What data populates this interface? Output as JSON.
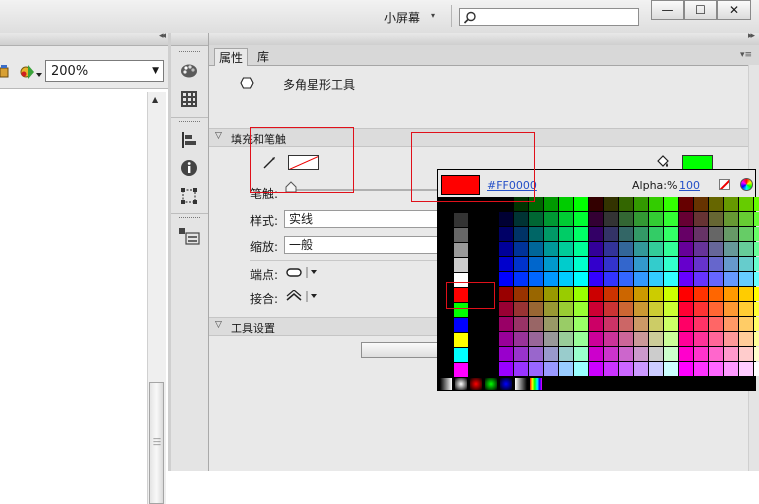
{
  "topbar": {
    "workspace_label": "小屏幕",
    "workspace_arrow": "▾",
    "search_value": "",
    "window_buttons": [
      "—",
      "☐",
      "✕"
    ]
  },
  "left_pane": {
    "zoom_value": "200%"
  },
  "properties_panel": {
    "tabs": [
      {
        "label": "属性",
        "active": true
      },
      {
        "label": "库",
        "active": false
      }
    ],
    "tool_name": "多角星形工具",
    "sections": {
      "fill_stroke": "填充和笔触",
      "tool_settings": "工具设置"
    },
    "fields": {
      "stroke_label": "笔触:",
      "style_label": "样式:",
      "style_value": "实线",
      "scale_label": "缩放:",
      "scale_value": "一般",
      "cap_label": "端点:",
      "join_label": "接合:"
    },
    "fill_color": "#00ff00"
  },
  "color_popup": {
    "selected_color": "#ff0000",
    "hex_text": "#FF0000",
    "alpha_label": "Alpha:%",
    "alpha_value": "100",
    "left_column": [
      "#000000",
      "#333333",
      "#666666",
      "#999999",
      "#cccccc",
      "#ffffff",
      "#ff0000",
      "#00ff00",
      "#0000ff",
      "#ffff00",
      "#00ffff",
      "#ff00ff"
    ],
    "gradients": [
      "#000000 to #ffffff linear",
      "#ffffff to #000000 radial",
      "red radial",
      "green radial",
      "blue radial",
      "#000000 to #ffffff radial",
      "rainbow"
    ]
  },
  "colors": {
    "highlight_box": "#e0101a",
    "link_blue": "#2550c8",
    "panel_bg": "#e9e9e9"
  }
}
